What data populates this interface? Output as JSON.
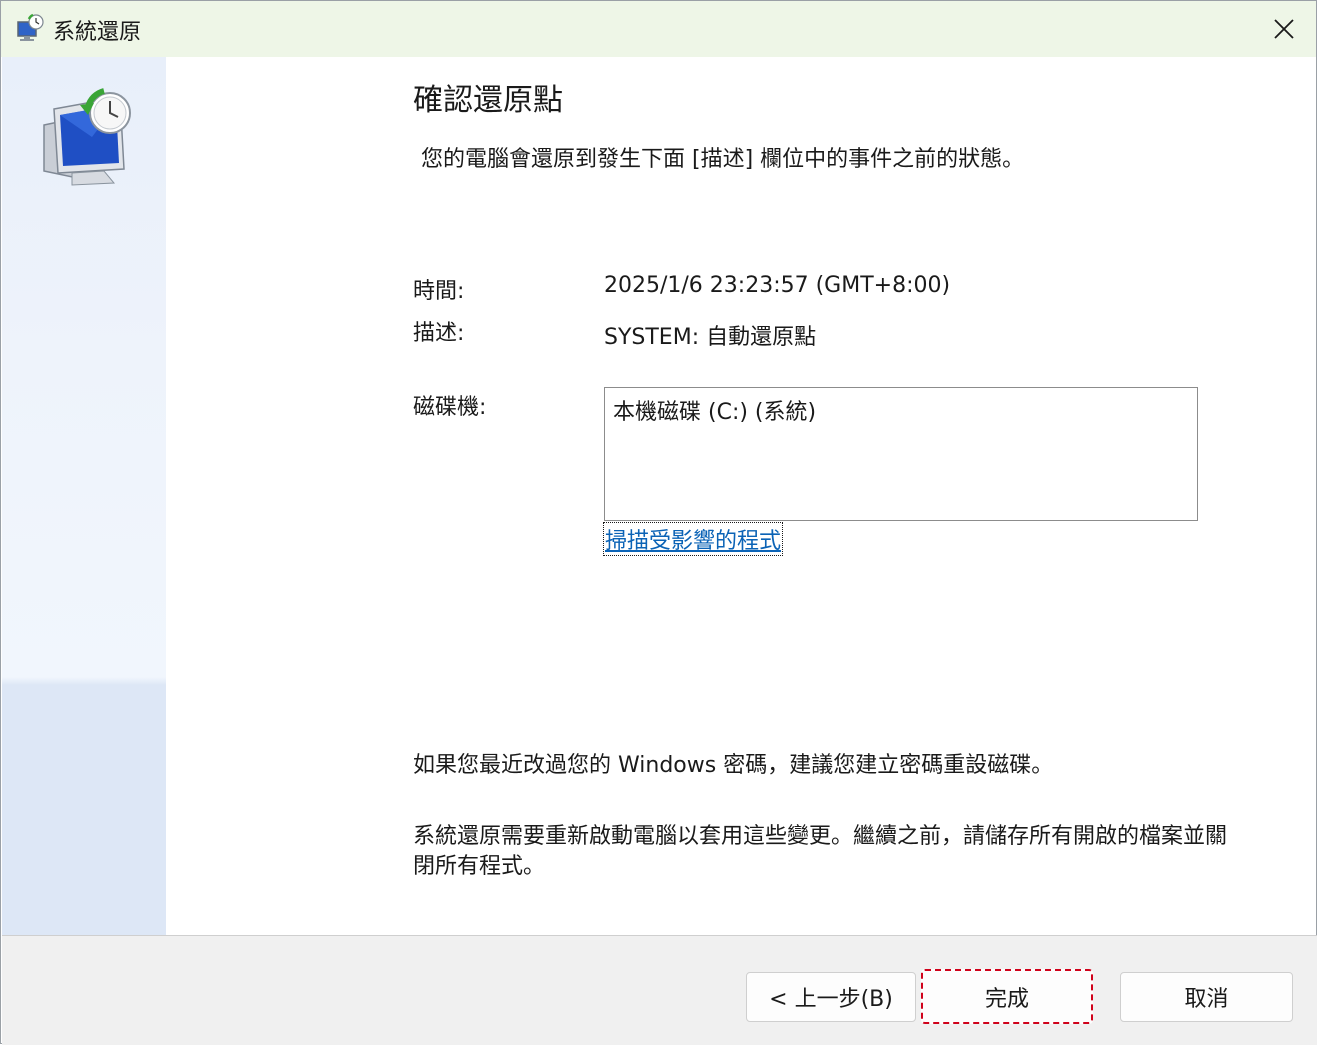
{
  "window": {
    "title": "系統還原"
  },
  "main": {
    "heading": "確認還原點",
    "intro": "您的電腦會還原到發生下面 [描述] 欄位中的事件之前的狀態。",
    "time_label": "時間:",
    "time_value": "2025/1/6 23:23:57 (GMT+8:00)",
    "description_label": "描述:",
    "description_value": "SYSTEM: 自動還原點",
    "drives_label": "磁碟機:",
    "drives": [
      "本機磁碟 (C:) (系統)"
    ],
    "scan_link": "掃描受影響的程式",
    "note_password": "如果您最近改過您的 Windows 密碼，建議您建立密碼重設磁碟。",
    "note_restart": "系統還原需要重新啟動電腦以套用這些變更。繼續之前，請儲存所有開啟的檔案並關閉所有程式。"
  },
  "footer": {
    "back_label": "< 上一步(B)",
    "finish_label": "完成",
    "cancel_label": "取消"
  },
  "colors": {
    "titlebar_bg": "#eef6e7",
    "sidebar_bg": "#e8effa",
    "link": "#0b63b6",
    "focus_outline": "#d0021b"
  }
}
